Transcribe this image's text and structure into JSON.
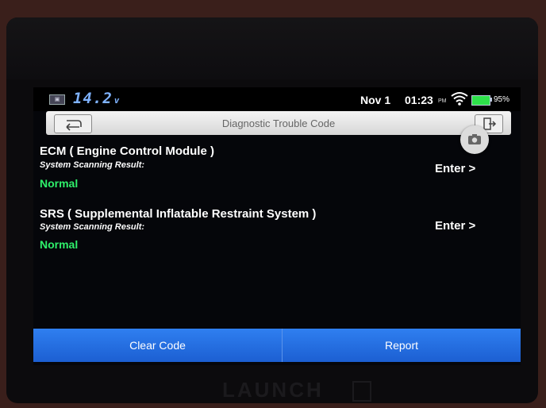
{
  "statusbar": {
    "voltage": "14.2",
    "voltage_unit": "v",
    "date": "Nov 1",
    "time": "01:23",
    "ampm": "PM",
    "battery_pct": "95%",
    "icons": [
      "battery-voltage-icon",
      "wifi-icon",
      "battery-icon"
    ]
  },
  "header": {
    "title": "Diagnostic Trouble Code",
    "icons": [
      "back-arrow-icon",
      "exit-icon",
      "camera-icon"
    ]
  },
  "systems": [
    {
      "name": "ECM ( Engine Control Module )",
      "subtitle": "System Scanning Result:",
      "status": "Normal",
      "action": "Enter >"
    },
    {
      "name": "SRS ( Supplemental Inflatable Restraint System )",
      "subtitle": "System Scanning Result:",
      "status": "Normal",
      "action": "Enter >"
    }
  ],
  "footer": {
    "clear_label": "Clear Code",
    "report_label": "Report"
  },
  "device": {
    "brand": "LAUNCH"
  },
  "colors": {
    "status_normal": "#2ef06a",
    "footer_blue": "#2f7ff0",
    "voltage": "#7fb3ff"
  }
}
